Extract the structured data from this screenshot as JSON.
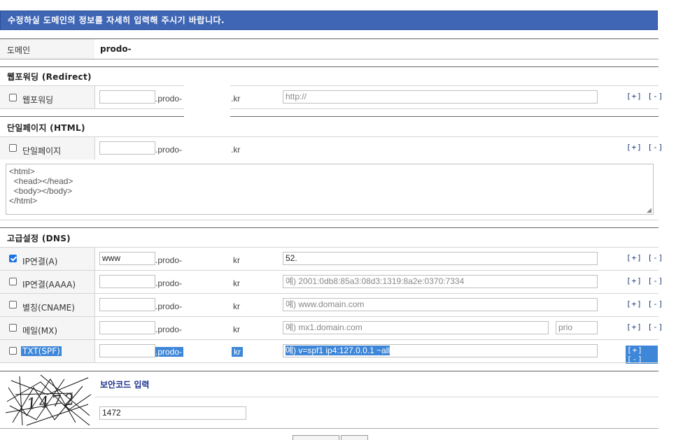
{
  "header": {
    "title": "수정하실 도메인의 정보를 자세히 입력해 주시기 바랍니다."
  },
  "domain_row": {
    "label": "도메인",
    "value": "prodo-"
  },
  "redirect": {
    "section_title": "웹포워딩 (Redirect)",
    "row": {
      "label": "웹포워딩",
      "checked": false,
      "sub_value": "",
      "domain": ".prodo-",
      "tld": ".kr",
      "url_placeholder": "http://",
      "plus": "[+]",
      "minus": "[-]"
    }
  },
  "html": {
    "section_title": "단일페이지 (HTML)",
    "row": {
      "label": "단일페이지",
      "checked": false,
      "sub_value": "",
      "domain": ".prodo-",
      "tld": ".kr",
      "plus": "[+]",
      "minus": "[-]"
    },
    "textarea": "<html>\n  <head></head>\n  <body></body>\n</html>"
  },
  "dns": {
    "section_title": "고급설정 (DNS)",
    "rows": [
      {
        "label": "IP연결(A)",
        "checked": true,
        "sub_value": "www",
        "domain": ".prodo-",
        "tld": "kr",
        "value": "52.",
        "placeholder": "",
        "plus": "[+]",
        "minus": "[-]"
      },
      {
        "label": "IP연결(AAAA)",
        "checked": false,
        "sub_value": "",
        "domain": ".prodo-",
        "tld": "kr",
        "value": "",
        "placeholder": "예) 2001:0db8:85a3:08d3:1319:8a2e:0370:7334",
        "plus": "[+]",
        "minus": "[-]"
      },
      {
        "label": "별칭(CNAME)",
        "checked": false,
        "sub_value": "",
        "domain": ".prodo-",
        "tld": "kr",
        "value": "",
        "placeholder": "예) www.domain.com",
        "plus": "[+]",
        "minus": "[-]"
      },
      {
        "label": "메일(MX)",
        "checked": false,
        "sub_value": "",
        "domain": ".prodo-",
        "tld": "kr",
        "value": "",
        "placeholder": "예) mx1.domain.com",
        "prio_placeholder": "prio",
        "plus": "[+]",
        "minus": "[-]"
      },
      {
        "label": "TXT(SPF)",
        "checked": false,
        "sub_value": "",
        "domain": ".prodo-",
        "tld": "kr",
        "value": "",
        "placeholder": "예) v=spf1 ip4:127.0.0.1 ~all",
        "plus": "[+]",
        "minus": "[-]"
      }
    ]
  },
  "security": {
    "label": "보안코드 입력",
    "captcha_text": "1472",
    "input_value": "1472"
  }
}
